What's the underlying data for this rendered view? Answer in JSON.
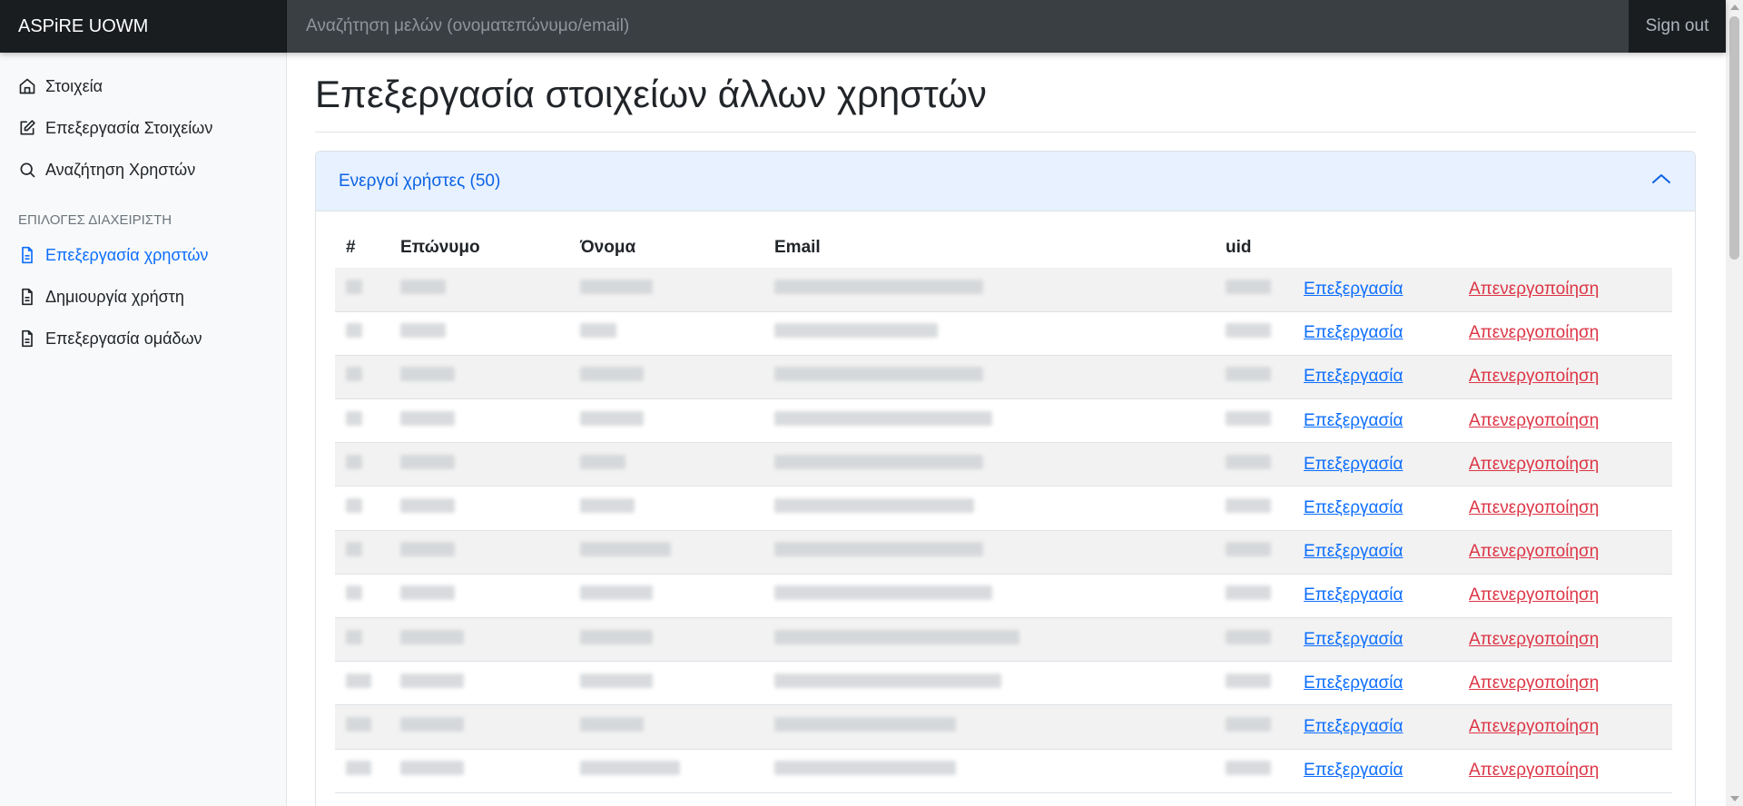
{
  "brand": "ASPiRE UOWM",
  "search": {
    "placeholder": "Αναζήτηση μελών (ονοματεπώνυμο/email)"
  },
  "signout": "Sign out",
  "sidebar": {
    "items": [
      {
        "label": "Στοιχεία",
        "icon": "home-icon"
      },
      {
        "label": "Επεξεργασία Στοιχείων",
        "icon": "edit-icon"
      },
      {
        "label": "Αναζήτηση Χρηστών",
        "icon": "search-icon"
      }
    ],
    "admin_heading": "ΕΠΙΛΟΓΕΣ ΔΙΑΧΕΙΡΙΣΤΗ",
    "admin_items": [
      {
        "label": "Επεξεργασία χρηστών",
        "icon": "file-icon",
        "active": true
      },
      {
        "label": "Δημιουργία χρήστη",
        "icon": "file-icon"
      },
      {
        "label": "Επεξεργασία ομάδων",
        "icon": "file-icon"
      }
    ]
  },
  "main": {
    "title": "Επεξεργασία στοιχείων άλλων χρηστών",
    "accordion_title": "Ενεργοί χρήστες (50)",
    "table": {
      "headers": [
        "#",
        "Επώνυμο",
        "Όνομα",
        "Email",
        "uid"
      ],
      "edit_label": "Επεξεργασία",
      "deactivate_label": "Απενεργοποίηση",
      "visible_rows": 12
    }
  },
  "colors": {
    "accent": "#0d6efd",
    "danger": "#dc3545",
    "navbar": "#212529"
  }
}
